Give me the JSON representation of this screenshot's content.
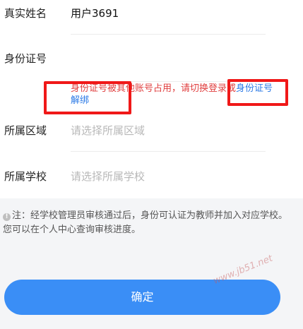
{
  "form": {
    "real_name_label": "真实姓名",
    "real_name_value": "用户3691",
    "id_number_label": "身份证号",
    "id_error_text": "身份证号被其他账号占用，请切换登录或",
    "id_error_link": "身份证号解绑",
    "region_label": "所属区域",
    "region_placeholder": "请选择所属区域",
    "school_label": "所属学校",
    "school_placeholder": "请选择所属学校"
  },
  "note": {
    "icon": "info-icon",
    "text": "注：经学校管理员审核通过后，身份可认证为教师并加入对应学校。您可以在个人中心查询审核进度。"
  },
  "confirm_button": "确定",
  "watermark": "www.jb51.net",
  "colors": {
    "accent": "#3a8ef6",
    "error": "#e04040",
    "link": "#2d7be6",
    "highlight": "#f01818"
  }
}
